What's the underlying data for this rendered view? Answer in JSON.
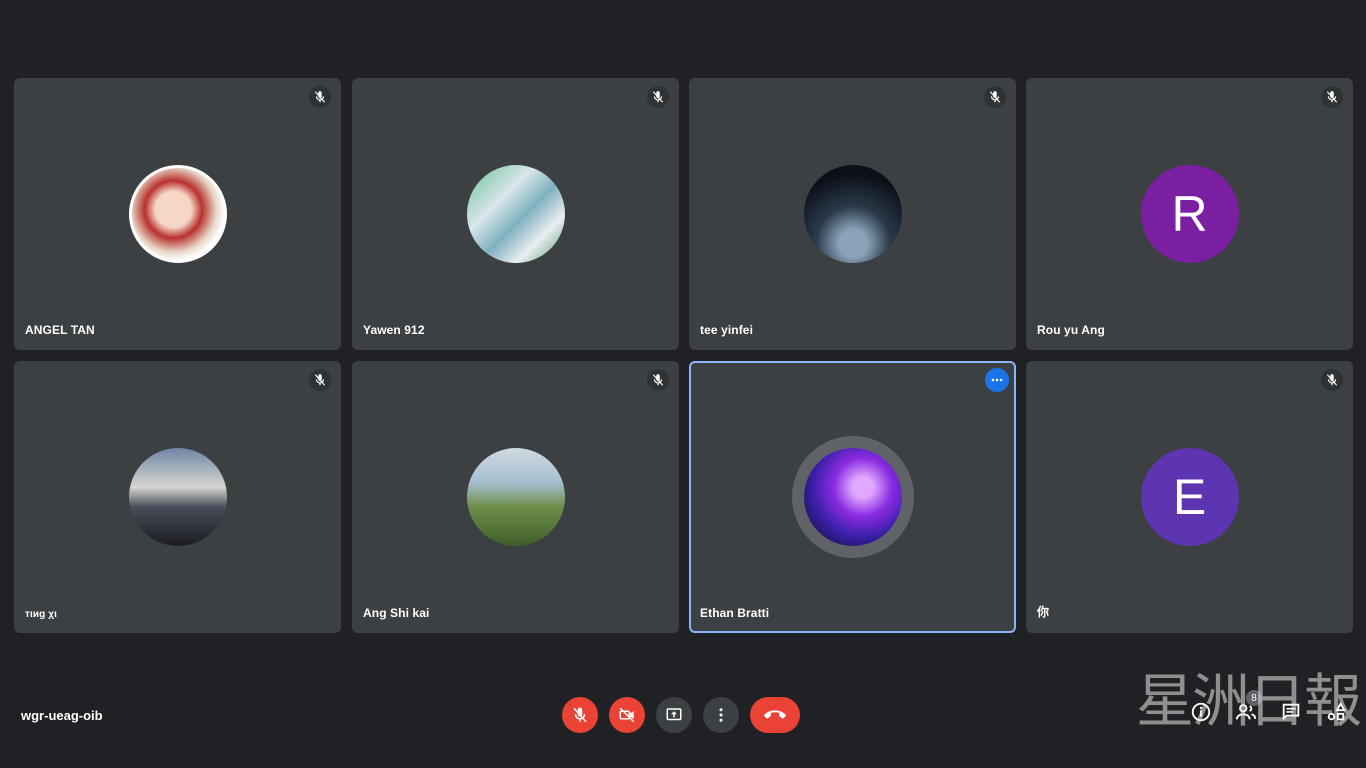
{
  "participants": [
    {
      "name": "ANGEL TAN",
      "avatar_letter": "",
      "muted": true
    },
    {
      "name": "Yawen 912",
      "avatar_letter": "",
      "muted": true
    },
    {
      "name": "tee yinfei",
      "avatar_letter": "",
      "muted": true
    },
    {
      "name": "Rou yu Ang",
      "avatar_letter": "R",
      "avatar_color": "#7b1fa2",
      "muted": true
    },
    {
      "name": "тιиg χι",
      "avatar_letter": "",
      "muted": true
    },
    {
      "name": "Ang Shi kai",
      "avatar_letter": "",
      "muted": true
    },
    {
      "name": "Ethan Bratti",
      "avatar_letter": "",
      "muted": false,
      "speaking": true
    },
    {
      "name": "你",
      "avatar_letter": "E",
      "avatar_color": "#5e35b1",
      "muted": true
    }
  ],
  "meeting": {
    "code": "wgr-ueag-oib"
  },
  "controls": {
    "mic": "mic-off-icon",
    "camera": "videocam-off-icon",
    "present": "present-screen-icon",
    "more": "more-vert-icon",
    "hangup": "call-end-icon"
  },
  "side_buttons": {
    "info": "info-icon",
    "people_count": "8",
    "chat": "chat-icon",
    "activities": "activities-icon"
  },
  "watermark": {
    "text": "星洲日報"
  },
  "colors": {
    "background": "#202124",
    "tile": "#3c4043",
    "danger": "#ea4335",
    "active_border": "#8ab4f8"
  }
}
